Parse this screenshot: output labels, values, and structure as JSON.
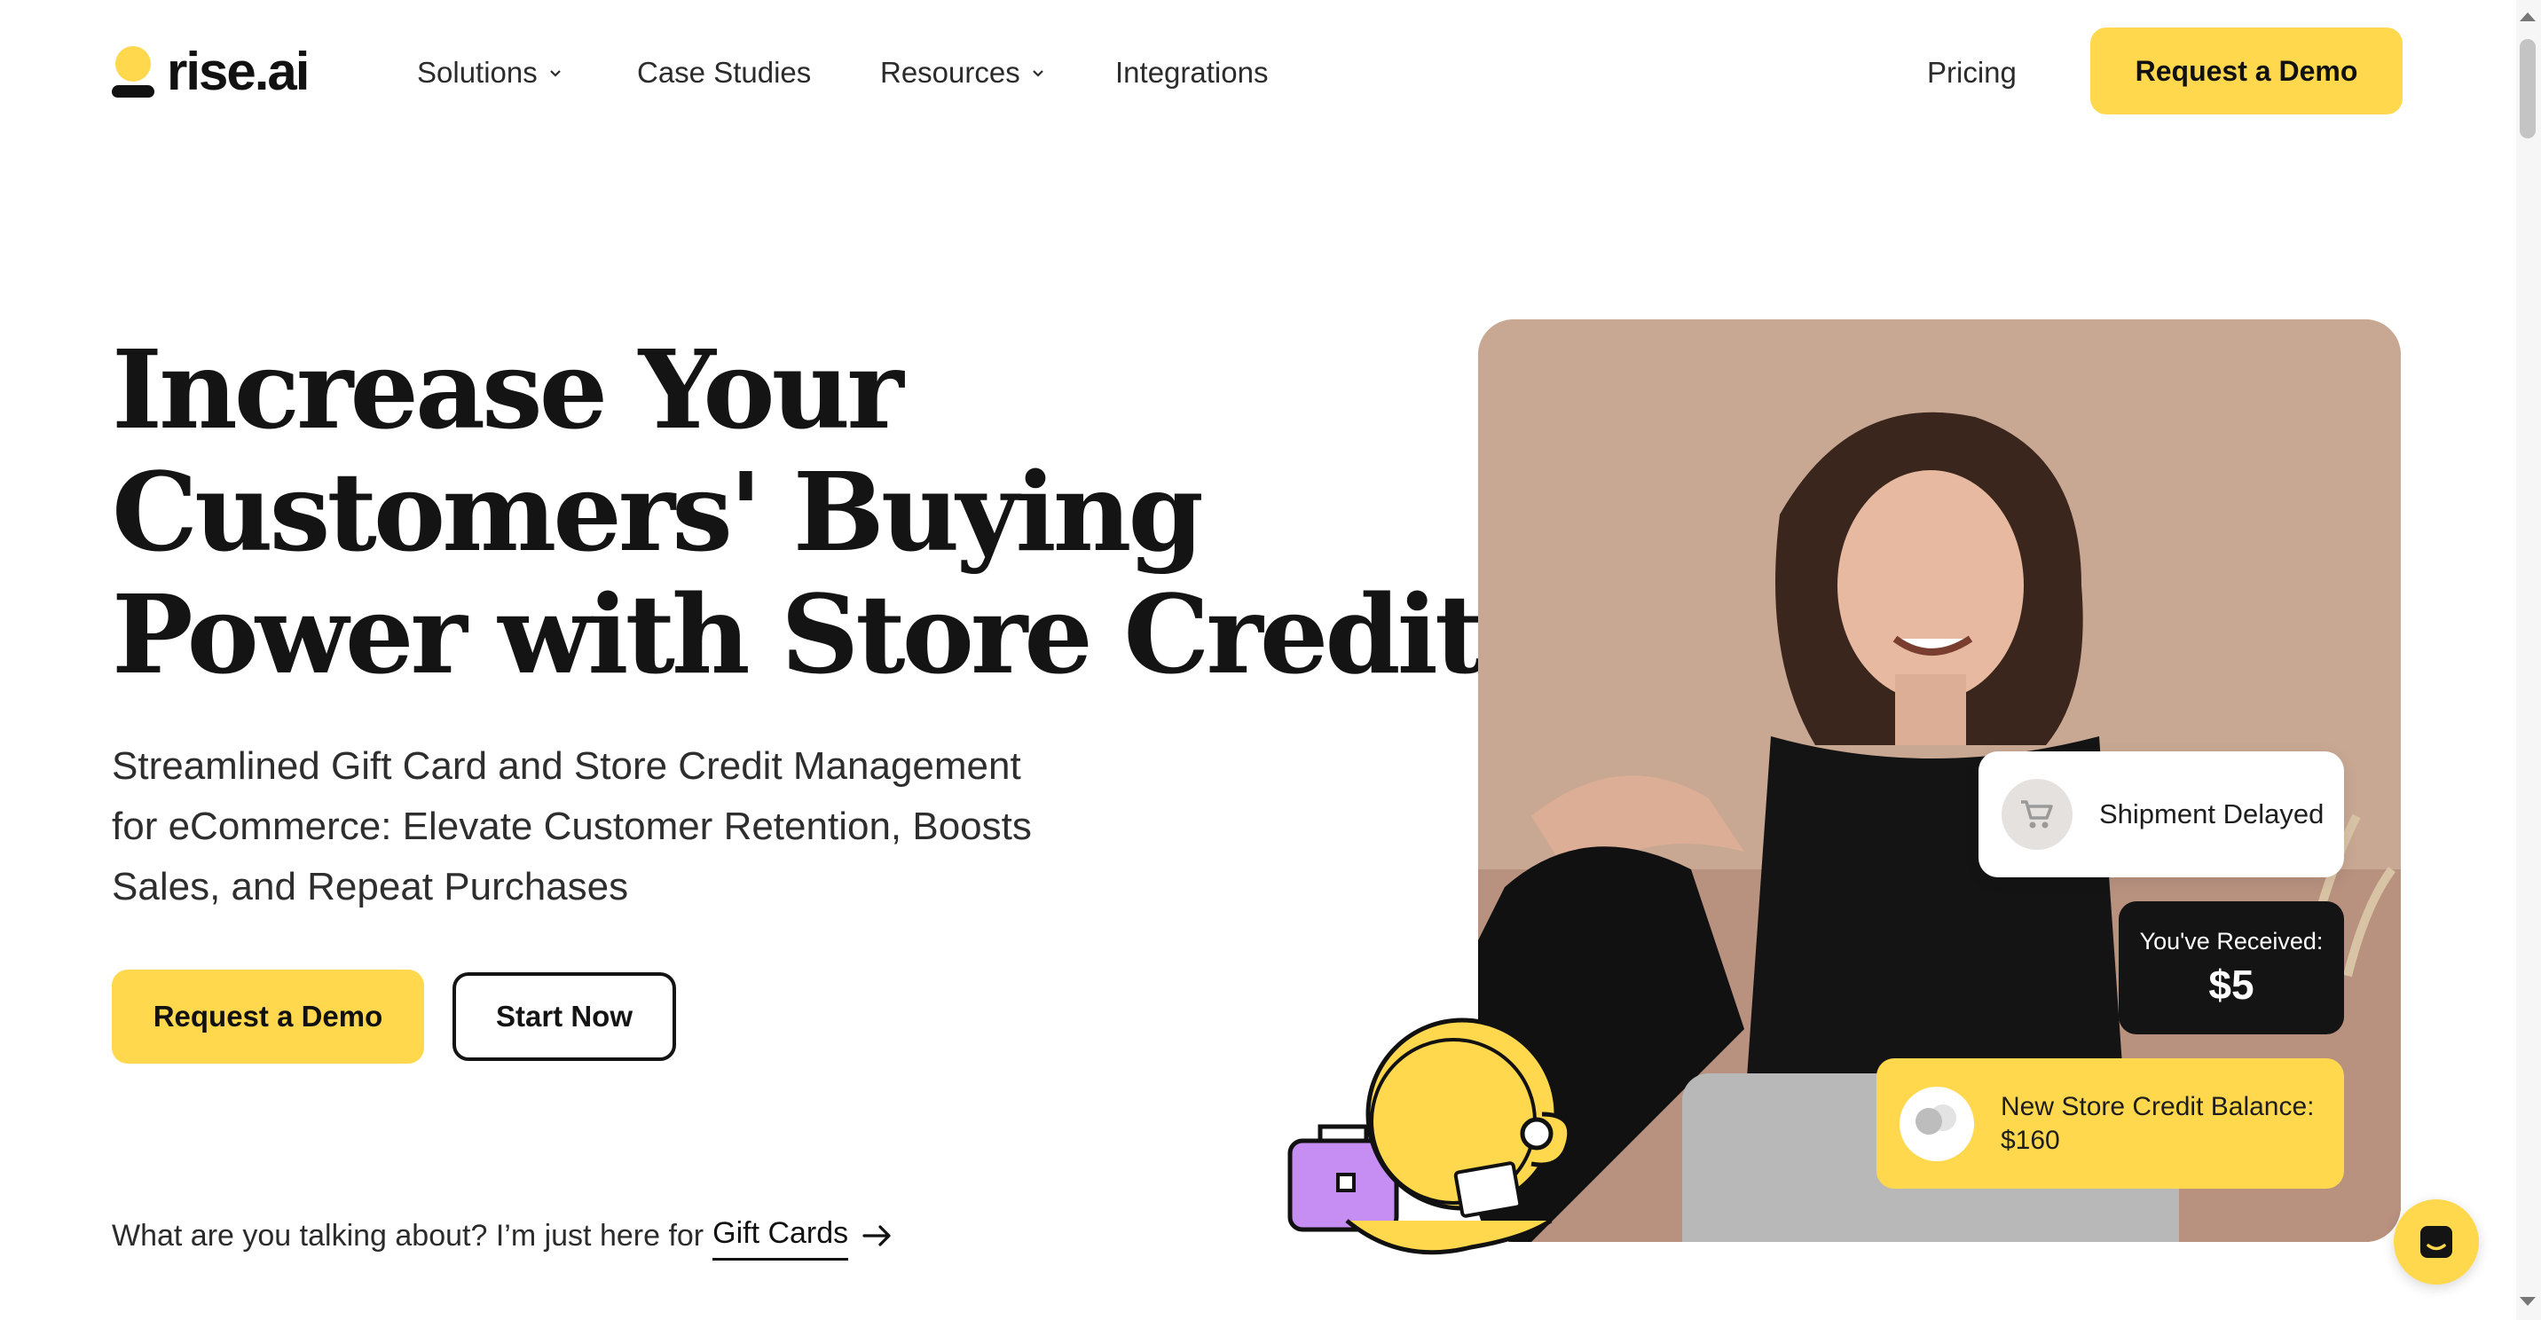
{
  "header": {
    "logo_text": "rise.ai",
    "nav": [
      {
        "label": "Solutions",
        "has_dropdown": true
      },
      {
        "label": "Case Studies",
        "has_dropdown": false
      },
      {
        "label": "Resources",
        "has_dropdown": true
      },
      {
        "label": "Integrations",
        "has_dropdown": false
      }
    ],
    "pricing_label": "Pricing",
    "demo_label": "Request a Demo"
  },
  "hero": {
    "title": "Increase Your Customers' Buying Power with Store Credit",
    "subtitle": "Streamlined Gift Card and Store Credit Management for eCommerce: Elevate Customer Retention, Boosts Sales, and Repeat Purchases",
    "primary_cta": "Request a Demo",
    "secondary_cta": "Start Now",
    "gift_prompt": "What are you talking about? I’m just here for",
    "gift_link": "Gift Cards"
  },
  "cards": {
    "shipment": "Shipment Delayed",
    "received_label": "You've Received:",
    "received_amount": "$5",
    "balance_label": "New Store Credit Balance: $160"
  },
  "icons": {
    "cart": "cart-icon",
    "arrow": "arrow-right-icon",
    "chat": "chat-icon",
    "chevron": "chevron-down-icon"
  },
  "colors": {
    "accent": "#ffd84d",
    "text": "#141414",
    "photo_bg": "#c8a893"
  }
}
